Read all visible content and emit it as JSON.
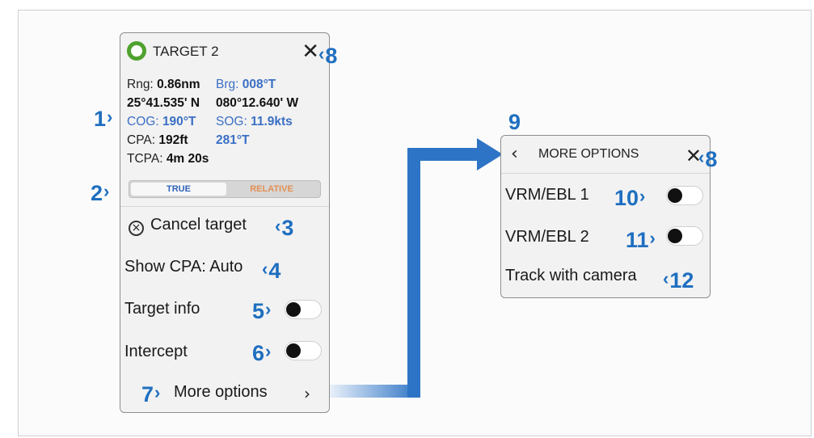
{
  "target_panel": {
    "title": "TARGET 2",
    "close_icon": "close-icon",
    "info": {
      "rng_label": "Rng:",
      "rng_value": "0.86nm",
      "brg_label": "Brg:",
      "brg_value": "008°T",
      "lat": "25°41.535' N",
      "lon": "080°12.640' W",
      "cog_label": "COG:",
      "cog_value": "190°T",
      "sog_label": "SOG:",
      "sog_value": "11.9kts",
      "cpa_label": "CPA:",
      "cpa_value": "192ft",
      "cpa_bearing": "281°T",
      "tcpa_label": "TCPA:",
      "tcpa_value": "4m 20s"
    },
    "mode_toggle": {
      "true_label": "TRUE",
      "relative_label": "RELATIVE",
      "selected": "TRUE"
    },
    "cancel_target": "Cancel target",
    "show_cpa": "Show CPA: Auto",
    "target_info": "Target info",
    "target_info_on": false,
    "intercept": "Intercept",
    "intercept_on": false,
    "more_options": "More options"
  },
  "more_options_panel": {
    "title": "MORE OPTIONS",
    "vrm_ebl_1": "VRM/EBL 1",
    "vrm_ebl_1_on": false,
    "vrm_ebl_2": "VRM/EBL 2",
    "vrm_ebl_2_on": false,
    "track_with_camera": "Track with camera"
  },
  "callouts": {
    "n1": "1",
    "n2": "2",
    "n3": "3",
    "n4": "4",
    "n5": "5",
    "n6": "6",
    "n7": "7",
    "n8a": "8",
    "n8b": "8",
    "n9": "9",
    "n10": "10",
    "n11": "11",
    "n12": "12"
  },
  "colors": {
    "callout_blue": "#1f6fc0",
    "target_green": "#4fa22f",
    "value_blue": "#3a6fc4",
    "relative_orange": "#e38f52"
  }
}
